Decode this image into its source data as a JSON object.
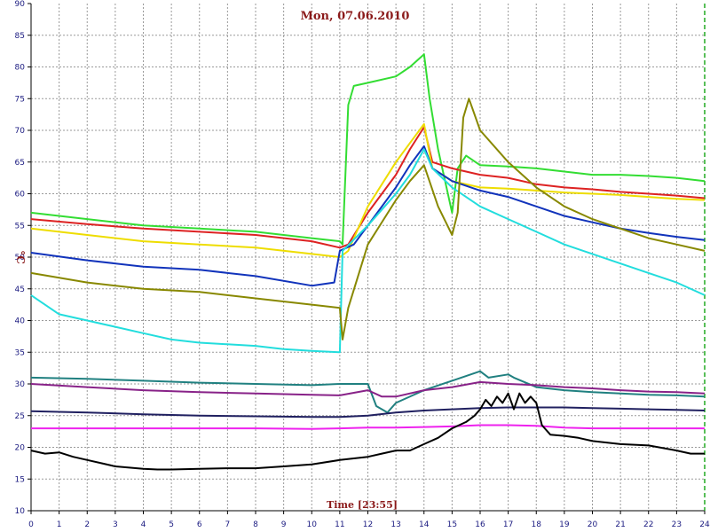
{
  "chart_data": {
    "type": "line",
    "title": "Mon, 07.06.2010",
    "xlabel": "Time [23:55]",
    "ylabel": "°C",
    "xlim": [
      0,
      24
    ],
    "ylim": [
      10,
      90
    ],
    "x_ticks": [
      "0",
      "1",
      "2",
      "3",
      "4",
      "5",
      "6",
      "7",
      "8",
      "9",
      "10",
      "11",
      "12",
      "13",
      "14",
      "15",
      "16",
      "17",
      "18",
      "19",
      "20",
      "21",
      "22",
      "23",
      "24"
    ],
    "y_ticks": [
      "10",
      "15",
      "20",
      "25",
      "30",
      "35",
      "40",
      "45",
      "50",
      "55",
      "60",
      "65",
      "70",
      "75",
      "80",
      "85",
      "90"
    ],
    "grid": true,
    "background": "#ffffff",
    "marker_x": 24,
    "series": [
      {
        "color": "#33dd33",
        "points": [
          [
            0,
            57
          ],
          [
            2,
            56
          ],
          [
            4,
            55
          ],
          [
            6,
            54.5
          ],
          [
            8,
            54
          ],
          [
            10,
            53
          ],
          [
            11,
            52.5
          ],
          [
            11.1,
            52
          ],
          [
            11.3,
            74
          ],
          [
            11.5,
            77
          ],
          [
            12,
            77.5
          ],
          [
            13,
            78.5
          ],
          [
            13.5,
            80
          ],
          [
            14,
            82
          ],
          [
            14.2,
            75
          ],
          [
            14.5,
            67
          ],
          [
            15,
            57
          ],
          [
            15.2,
            64
          ],
          [
            15.5,
            66
          ],
          [
            16,
            64.5
          ],
          [
            17,
            64.3
          ],
          [
            18,
            64
          ],
          [
            19,
            63.5
          ],
          [
            20,
            63
          ],
          [
            21,
            63
          ],
          [
            22,
            62.8
          ],
          [
            23,
            62.5
          ],
          [
            24,
            62
          ]
        ]
      },
      {
        "color": "#dd2222",
        "points": [
          [
            0,
            56
          ],
          [
            2,
            55.2
          ],
          [
            4,
            54.5
          ],
          [
            6,
            54
          ],
          [
            8,
            53.5
          ],
          [
            10,
            52.5
          ],
          [
            11,
            51.5
          ],
          [
            11.3,
            52
          ],
          [
            12,
            57
          ],
          [
            13,
            63
          ],
          [
            13.5,
            67
          ],
          [
            14,
            70.5
          ],
          [
            14.3,
            65
          ],
          [
            15,
            64
          ],
          [
            16,
            63
          ],
          [
            17,
            62.5
          ],
          [
            18,
            61.5
          ],
          [
            19,
            61
          ],
          [
            20,
            60.7
          ],
          [
            21,
            60.3
          ],
          [
            22,
            60
          ],
          [
            23,
            59.7
          ],
          [
            24,
            59.3
          ]
        ]
      },
      {
        "color": "#eedd00",
        "points": [
          [
            0,
            54.5
          ],
          [
            2,
            53.5
          ],
          [
            4,
            52.5
          ],
          [
            6,
            52
          ],
          [
            8,
            51.5
          ],
          [
            10,
            50.5
          ],
          [
            11,
            50
          ],
          [
            11.3,
            51
          ],
          [
            12,
            58
          ],
          [
            13,
            65
          ],
          [
            13.5,
            68
          ],
          [
            14,
            71
          ],
          [
            14.3,
            64
          ],
          [
            15,
            62
          ],
          [
            16,
            61
          ],
          [
            17,
            60.8
          ],
          [
            18,
            60.5
          ],
          [
            19,
            60.2
          ],
          [
            20,
            60
          ],
          [
            21,
            59.8
          ],
          [
            22,
            59.5
          ],
          [
            23,
            59.2
          ],
          [
            24,
            59
          ]
        ]
      },
      {
        "color": "#1133bb",
        "points": [
          [
            0,
            50.7
          ],
          [
            2,
            49.5
          ],
          [
            4,
            48.5
          ],
          [
            6,
            48
          ],
          [
            8,
            47
          ],
          [
            10,
            45.5
          ],
          [
            10.8,
            46
          ],
          [
            11,
            51
          ],
          [
            11.5,
            52
          ],
          [
            12,
            55
          ],
          [
            13,
            61
          ],
          [
            13.5,
            64.5
          ],
          [
            14,
            67.5
          ],
          [
            14.3,
            64
          ],
          [
            15,
            62
          ],
          [
            16,
            60.5
          ],
          [
            17,
            59.5
          ],
          [
            18,
            58
          ],
          [
            19,
            56.5
          ],
          [
            20,
            55.5
          ],
          [
            21,
            54.5
          ],
          [
            22,
            53.8
          ],
          [
            23,
            53.2
          ],
          [
            24,
            52.7
          ]
        ]
      },
      {
        "color": "#22dddd",
        "points": [
          [
            0,
            44
          ],
          [
            1,
            41
          ],
          [
            2,
            40
          ],
          [
            3,
            39
          ],
          [
            4,
            38
          ],
          [
            5,
            37
          ],
          [
            6,
            36.5
          ],
          [
            8,
            36
          ],
          [
            9,
            35.5
          ],
          [
            10,
            35.2
          ],
          [
            11,
            35
          ],
          [
            11.1,
            51
          ],
          [
            12,
            55
          ],
          [
            13,
            60
          ],
          [
            13.5,
            63
          ],
          [
            14,
            67
          ],
          [
            14.3,
            64
          ],
          [
            15,
            61
          ],
          [
            16,
            58
          ],
          [
            17,
            56
          ],
          [
            18,
            54
          ],
          [
            19,
            52
          ],
          [
            20,
            50.5
          ],
          [
            21,
            49
          ],
          [
            22,
            47.5
          ],
          [
            23,
            46
          ],
          [
            24,
            44
          ]
        ]
      },
      {
        "color": "#888800",
        "points": [
          [
            0,
            47.5
          ],
          [
            2,
            46
          ],
          [
            4,
            45
          ],
          [
            6,
            44.5
          ],
          [
            8,
            43.5
          ],
          [
            10,
            42.5
          ],
          [
            11,
            42
          ],
          [
            11.1,
            37
          ],
          [
            11.3,
            42
          ],
          [
            12,
            52
          ],
          [
            13,
            59
          ],
          [
            13.5,
            62
          ],
          [
            14,
            64.5
          ],
          [
            14.5,
            58
          ],
          [
            15,
            53.5
          ],
          [
            15.2,
            57
          ],
          [
            15.4,
            72
          ],
          [
            15.6,
            75
          ],
          [
            16,
            70
          ],
          [
            17,
            65
          ],
          [
            18,
            61
          ],
          [
            19,
            58
          ],
          [
            20,
            56
          ],
          [
            21,
            54.5
          ],
          [
            22,
            53
          ],
          [
            23,
            52
          ],
          [
            24,
            51
          ]
        ]
      },
      {
        "color": "#208080",
        "points": [
          [
            0,
            31
          ],
          [
            2,
            30.8
          ],
          [
            4,
            30.5
          ],
          [
            6,
            30.2
          ],
          [
            8,
            30
          ],
          [
            10,
            29.8
          ],
          [
            11,
            30
          ],
          [
            12,
            30
          ],
          [
            12.3,
            26.5
          ],
          [
            12.7,
            25.5
          ],
          [
            13,
            27
          ],
          [
            14,
            29
          ],
          [
            15,
            30.5
          ],
          [
            16,
            32
          ],
          [
            16.3,
            31
          ],
          [
            17,
            31.5
          ],
          [
            17.2,
            31
          ],
          [
            18,
            29.5
          ],
          [
            19,
            29
          ],
          [
            20,
            28.7
          ],
          [
            21,
            28.5
          ],
          [
            22,
            28.3
          ],
          [
            23,
            28.2
          ],
          [
            24,
            28
          ]
        ]
      },
      {
        "color": "#882288",
        "points": [
          [
            0,
            30
          ],
          [
            2,
            29.5
          ],
          [
            4,
            29
          ],
          [
            6,
            28.7
          ],
          [
            8,
            28.5
          ],
          [
            10,
            28.3
          ],
          [
            11,
            28.2
          ],
          [
            12,
            29
          ],
          [
            12.5,
            28
          ],
          [
            13,
            28
          ],
          [
            14,
            29
          ],
          [
            15,
            29.5
          ],
          [
            16,
            30.3
          ],
          [
            17,
            30
          ],
          [
            18,
            29.8
          ],
          [
            19,
            29.5
          ],
          [
            20,
            29.3
          ],
          [
            21,
            29
          ],
          [
            22,
            28.8
          ],
          [
            23,
            28.7
          ],
          [
            24,
            28.5
          ]
        ]
      },
      {
        "color": "#202060",
        "points": [
          [
            0,
            25.7
          ],
          [
            2,
            25.5
          ],
          [
            4,
            25.2
          ],
          [
            6,
            25
          ],
          [
            8,
            24.9
          ],
          [
            10,
            24.8
          ],
          [
            11,
            24.8
          ],
          [
            12,
            25
          ],
          [
            13,
            25.5
          ],
          [
            14,
            25.8
          ],
          [
            15,
            26
          ],
          [
            16,
            26.2
          ],
          [
            17,
            26.3
          ],
          [
            18,
            26.3
          ],
          [
            19,
            26.3
          ],
          [
            20,
            26.2
          ],
          [
            21,
            26.1
          ],
          [
            22,
            26
          ],
          [
            23,
            25.9
          ],
          [
            24,
            25.8
          ]
        ]
      },
      {
        "color": "#ee22ee",
        "points": [
          [
            0,
            23
          ],
          [
            2,
            23
          ],
          [
            4,
            23
          ],
          [
            6,
            23
          ],
          [
            8,
            23
          ],
          [
            10,
            22.9
          ],
          [
            11,
            23
          ],
          [
            12,
            23.1
          ],
          [
            13,
            23.1
          ],
          [
            14,
            23.2
          ],
          [
            15,
            23.3
          ],
          [
            16,
            23.5
          ],
          [
            17,
            23.5
          ],
          [
            18,
            23.4
          ],
          [
            19,
            23.1
          ],
          [
            20,
            23
          ],
          [
            21,
            23
          ],
          [
            22,
            23
          ],
          [
            23,
            23
          ],
          [
            24,
            23
          ]
        ]
      },
      {
        "color": "#000000",
        "points": [
          [
            0,
            19.5
          ],
          [
            0.5,
            19
          ],
          [
            1,
            19.2
          ],
          [
            1.5,
            18.5
          ],
          [
            2,
            18
          ],
          [
            2.5,
            17.5
          ],
          [
            3,
            17
          ],
          [
            3.5,
            16.8
          ],
          [
            4,
            16.6
          ],
          [
            4.5,
            16.5
          ],
          [
            5,
            16.5
          ],
          [
            6,
            16.6
          ],
          [
            7,
            16.7
          ],
          [
            8,
            16.7
          ],
          [
            9,
            17
          ],
          [
            10,
            17.3
          ],
          [
            11,
            18
          ],
          [
            12,
            18.5
          ],
          [
            12.5,
            19
          ],
          [
            13,
            19.5
          ],
          [
            13.5,
            19.5
          ],
          [
            14,
            20.5
          ],
          [
            14.5,
            21.5
          ],
          [
            15,
            23
          ],
          [
            15.5,
            24
          ],
          [
            15.8,
            25
          ],
          [
            16,
            26
          ],
          [
            16.2,
            27.5
          ],
          [
            16.4,
            26.5
          ],
          [
            16.6,
            28
          ],
          [
            16.8,
            27
          ],
          [
            17,
            28.5
          ],
          [
            17.2,
            26
          ],
          [
            17.4,
            28.5
          ],
          [
            17.6,
            27
          ],
          [
            17.8,
            28
          ],
          [
            18,
            27
          ],
          [
            18.2,
            23.5
          ],
          [
            18.5,
            22
          ],
          [
            19,
            21.8
          ],
          [
            19.5,
            21.5
          ],
          [
            20,
            21
          ],
          [
            21,
            20.5
          ],
          [
            22,
            20.3
          ],
          [
            23,
            19.5
          ],
          [
            23.5,
            19
          ],
          [
            24,
            19
          ]
        ]
      }
    ]
  }
}
